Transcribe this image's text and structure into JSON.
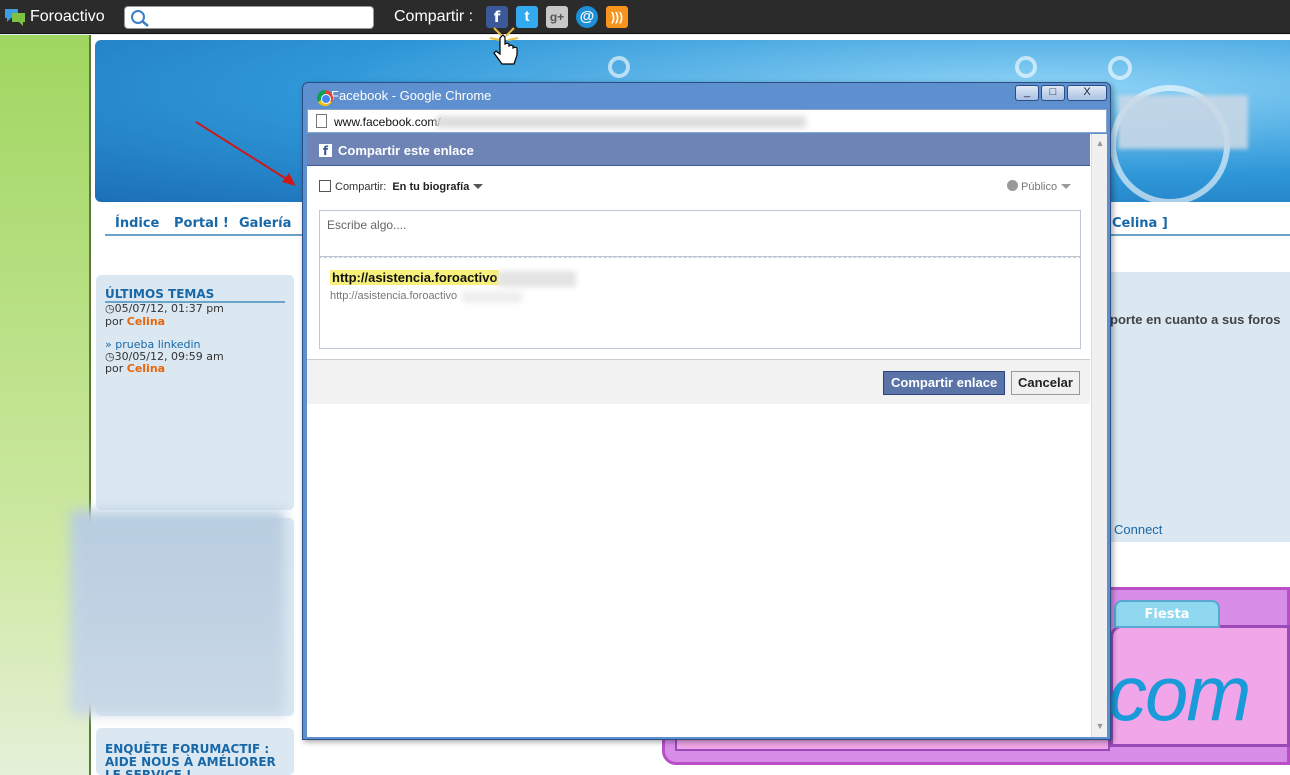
{
  "toolbar": {
    "brand": "Foroactivo",
    "search_placeholder": "",
    "share_label": "Compartir :",
    "share_icons": [
      "facebook-icon",
      "twitter-icon",
      "google-plus-icon",
      "email-icon",
      "rss-icon"
    ]
  },
  "forum": {
    "nav": {
      "index": "Índice",
      "portal": "Portal !",
      "gallery": "Galería",
      "user": "Celina ]"
    },
    "latest": {
      "title": "ÚLTIMOS TEMAS",
      "item1_date": "05/07/12, 01:37 pm",
      "item1_by": "por",
      "item1_author": "Celina",
      "item2_title": "» prueba linkedin",
      "item2_date": "30/05/12, 09:59 am",
      "item2_by": "por",
      "item2_author": "Celina"
    },
    "survey_title": "ENQUÊTE FORUMACTIF : AIDE NOUS À AMÉLIORER LE SERVICE !",
    "right_text": "porte en cuanto a sus foros",
    "connect": "Connect",
    "fiesta": "Fiesta",
    "com": "com"
  },
  "popup": {
    "title": "Facebook - Google Chrome",
    "url": "www.facebook.com/",
    "header": "Compartir este enlace",
    "share_label": "Compartir:",
    "share_target": "En tu biografía",
    "audience": "Público",
    "textarea_placeholder": "Escribe algo....",
    "link_title": "http://asistencia.foroactivo",
    "link_url": "http://asistencia.foroactivo",
    "share_button": "Compartir enlace",
    "cancel_button": "Cancelar",
    "window_buttons": {
      "minimize": "_",
      "maximize": "□",
      "close": "X"
    }
  },
  "colors": {
    "facebook_blue": "#3b5998",
    "facebook_header": "#6d84b4",
    "toolbar_bg": "#2b2b2b",
    "forum_link": "#1868a8",
    "author_orange": "#e8650a"
  }
}
